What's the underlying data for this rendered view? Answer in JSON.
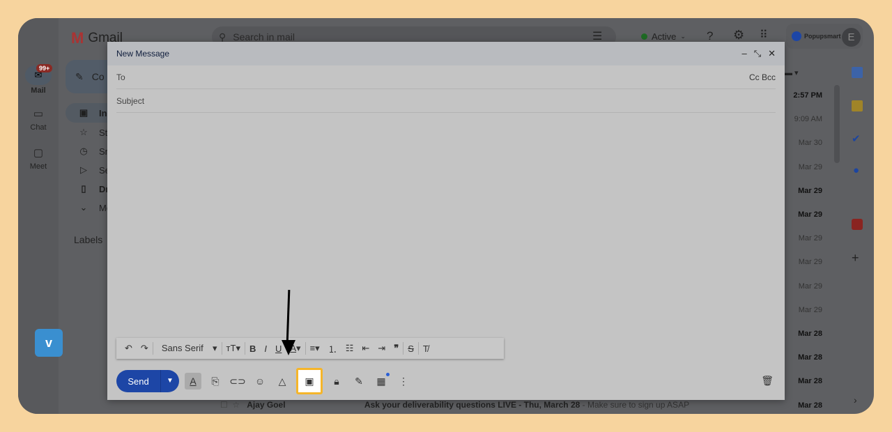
{
  "app": {
    "name": "Gmail",
    "search_placeholder": "Search in mail",
    "status": "Active",
    "account_brand": "Popupsmart",
    "avatar_letter": "E"
  },
  "rail": [
    {
      "label": "Mail",
      "badge": "99+"
    },
    {
      "label": "Chat"
    },
    {
      "label": "Meet"
    }
  ],
  "nav": {
    "compose": "Co",
    "items": [
      "Inb",
      "Sta",
      "Sno",
      "Sen",
      "Dra",
      "Mo"
    ],
    "labels": "Labels"
  },
  "list": {
    "dates": [
      {
        "t": "2:57 PM",
        "bold": true
      },
      {
        "t": "9:09 AM",
        "bold": false
      },
      {
        "t": "Mar 30",
        "bold": false
      },
      {
        "t": "Mar 29",
        "bold": false
      },
      {
        "t": "Mar 29",
        "bold": true
      },
      {
        "t": "Mar 29",
        "bold": true
      },
      {
        "t": "Mar 29",
        "bold": false
      },
      {
        "t": "Mar 29",
        "bold": false
      },
      {
        "t": "Mar 29",
        "bold": false
      },
      {
        "t": "Mar 29",
        "bold": false
      },
      {
        "t": "Mar 28",
        "bold": true
      },
      {
        "t": "Mar 28",
        "bold": true
      },
      {
        "t": "Mar 28",
        "bold": true
      },
      {
        "t": "Mar 28",
        "bold": true
      }
    ],
    "last_row": {
      "sender": "Ajay Goel",
      "subject": "Ask your deliverability questions LIVE - Thu, March 28",
      "snippet": " - Make sure to sign up ASAP",
      "more": "..."
    }
  },
  "compose": {
    "title": "New Message",
    "to_label": "To",
    "cc_bcc": "Cc Bcc",
    "subject_placeholder": "Subject",
    "font": "Sans Serif",
    "send": "Send"
  },
  "colors": {
    "send": "#1d46a6",
    "highlight": "#f5b52a",
    "background": "#f7d49e"
  }
}
